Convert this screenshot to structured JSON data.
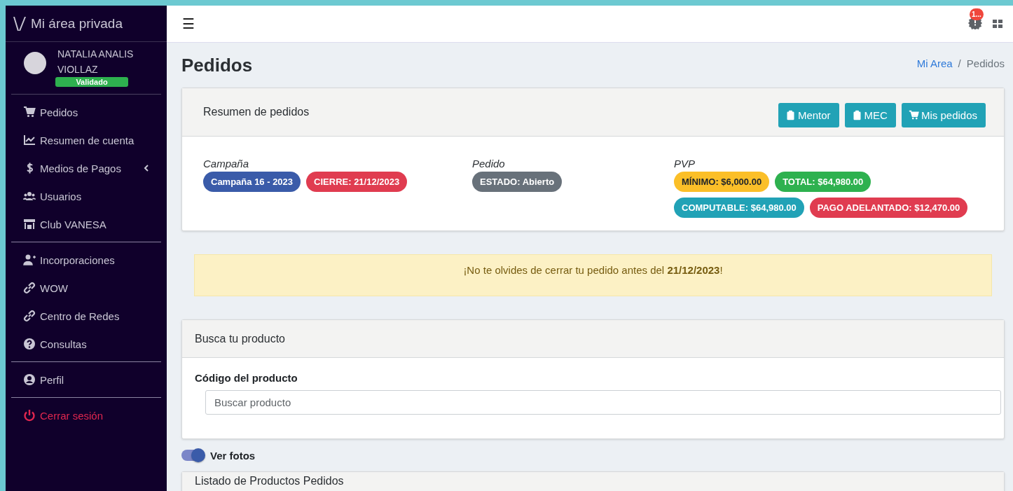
{
  "sidebar": {
    "brand": "Mi área privada",
    "user": {
      "name": "NATALIA ANALIS VIOLLAZ",
      "status": "Validado"
    },
    "groups": [
      [
        {
          "label": "Pedidos",
          "kind": "link"
        },
        {
          "label": "Resumen de cuenta",
          "kind": "link"
        },
        {
          "label": "Medios de Pagos",
          "kind": "submenu",
          "expanded": false
        },
        {
          "label": "Usuarios",
          "kind": "link"
        },
        {
          "label": "Club VANESA",
          "kind": "link"
        }
      ],
      [
        {
          "label": "Incorporaciones",
          "kind": "link"
        },
        {
          "label": "WOW",
          "kind": "link"
        },
        {
          "label": "Centro de Redes",
          "kind": "link"
        },
        {
          "label": "Consultas",
          "kind": "link"
        }
      ],
      [
        {
          "label": "Perfil",
          "kind": "link"
        }
      ],
      [
        {
          "label": "Cerrar sesión",
          "kind": "logout"
        }
      ]
    ]
  },
  "topbar": {
    "menu_glyph": "☰",
    "notification_count": "1..."
  },
  "page": {
    "title": "Pedidos",
    "breadcrumb_separator": "/",
    "breadcrumb": [
      {
        "label": "Mi Area",
        "kind": "link"
      },
      {
        "label": "Pedidos",
        "kind": "current"
      }
    ]
  },
  "summary": {
    "title": "Resumen de pedidos",
    "buttons": [
      {
        "label": "Mentor"
      },
      {
        "label": "MEC"
      },
      {
        "label": "Mis pedidos"
      }
    ],
    "sections": [
      {
        "label": "Campaña",
        "badges": [
          {
            "text": "Campaña 16 - 2023",
            "color": "#3a5ba9"
          },
          {
            "text": "CIERRE: 21/12/2023",
            "color": "#e03c50"
          }
        ]
      },
      {
        "label": "Pedido",
        "badges": [
          {
            "text": "ESTADO: Abierto",
            "color": "#68717a"
          }
        ]
      },
      {
        "label": "PVP",
        "badges": [
          {
            "text": "MÍNIMO: $6,000.00",
            "color": "#fbbf28"
          },
          {
            "text": "TOTAL: $64,980.00",
            "color": "#2eb14f"
          },
          {
            "text": "COMPUTABLE: $64,980.00",
            "color": "#21a2b6"
          },
          {
            "text": "PAGO ADELANTADO: $12,470.00",
            "color": "#e03c50"
          }
        ]
      }
    ]
  },
  "alert": {
    "text": "¡No te olvides de cerrar tu pedido antes del **21/12/2023**!"
  },
  "search_card": {
    "title": "Busca tu producto",
    "field_label": "Código del producto",
    "placeholder": "Buscar producto"
  },
  "photos_toggle": {
    "label": "Ver fotos",
    "on": true
  },
  "list_card": {
    "title": "Listado de Productos Pedidos"
  }
}
